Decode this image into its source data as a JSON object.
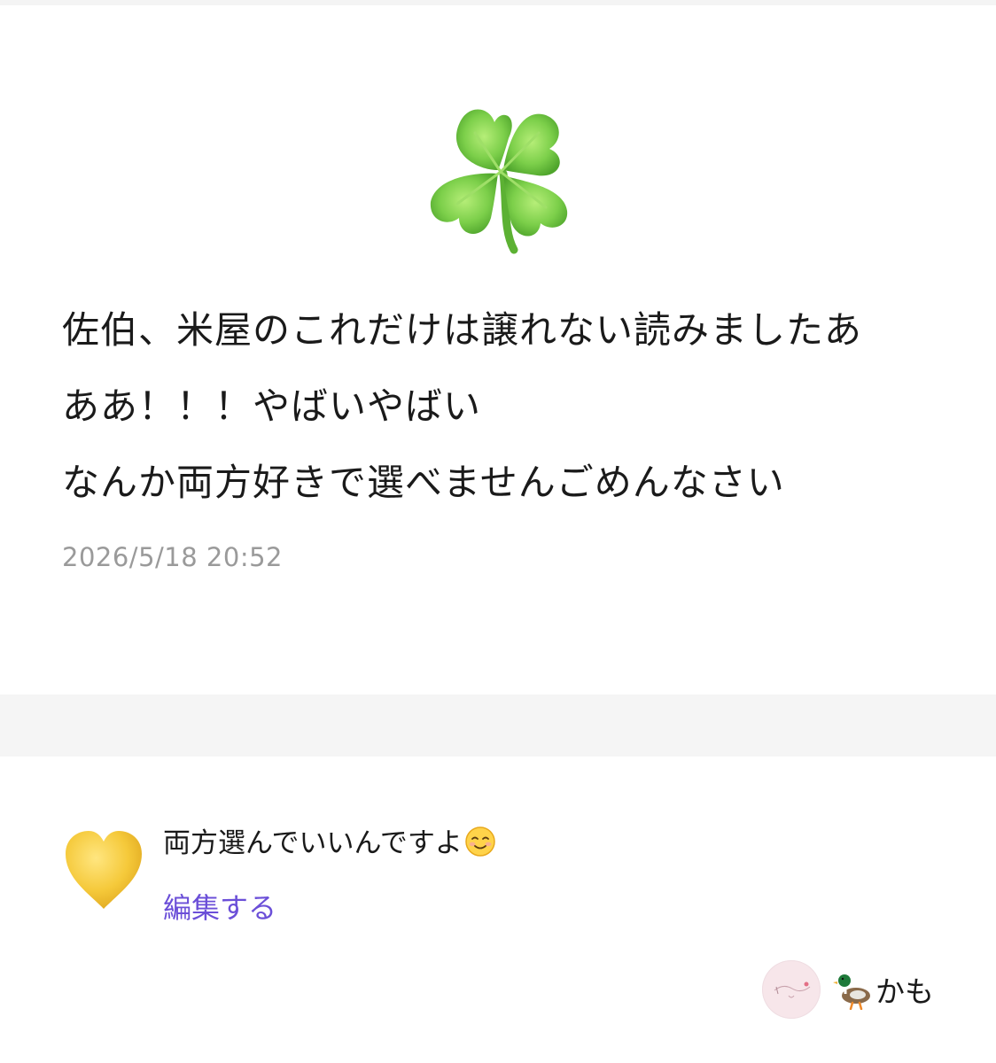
{
  "message": {
    "lines": [
      "佐伯、米屋のこれだけは譲れない読みましたあ",
      "ああ！！！やばいやばい",
      "なんか両方好きで選べませんごめんなさい"
    ],
    "timestamp": "2026/5/18 20:52",
    "icon": "four-leaf-clover-icon"
  },
  "reply": {
    "icon": "yellow-heart-icon",
    "text": "両方選んでいいんですよ",
    "emoji": "smiling-face-icon",
    "edit_label": "編集する"
  },
  "author": {
    "avatar": "avatar",
    "icon": "duck-icon",
    "name": "かも"
  },
  "colors": {
    "link": "#6b4fd8",
    "timestamp": "#9a9a9a",
    "band": "#f5f5f5",
    "heart": "#f5c93a",
    "clover": "#7ccf4a"
  }
}
